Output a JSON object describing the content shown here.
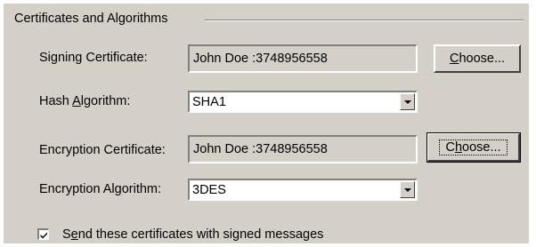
{
  "group": {
    "title": "Certificates and Algorithms"
  },
  "signing": {
    "label_pre": "Signing Certificate:",
    "value": "John Doe  :3748956558",
    "button_pre": "",
    "button_key": "C",
    "button_post": "hoose..."
  },
  "hash": {
    "label_pre": "Hash ",
    "label_key": "A",
    "label_post": "lgorithm:",
    "value": "SHA1",
    "arrow_icon": "chevron-down-icon"
  },
  "encryption_cert": {
    "label_pre": "Encryption Certificate:",
    "value": "John Doe  :3748956558",
    "button_pre": "C",
    "button_key": "h",
    "button_post": "oose..."
  },
  "encryption_alg": {
    "label_pre": "Encryption Al",
    "label_key": "g",
    "label_post": "orithm:",
    "value": "3DES",
    "arrow_icon": "chevron-down-icon"
  },
  "send_certs": {
    "label_pre": "S",
    "label_key": "e",
    "label_post": "nd these certificates with signed messages",
    "checked": true,
    "check_icon": "checkmark-icon"
  },
  "colors": {
    "face": "#d4d0c8",
    "shadow": "#808080",
    "highlight": "#ffffff",
    "dark_shadow": "#404040",
    "window": "#ffffff"
  }
}
